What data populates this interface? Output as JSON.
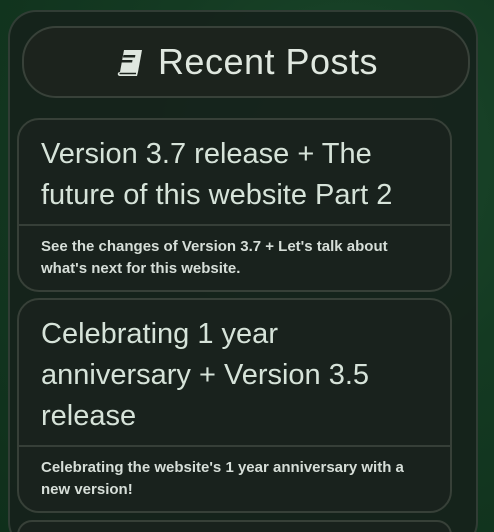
{
  "widget": {
    "title": "Recent Posts",
    "icon": "book-icon",
    "posts": [
      {
        "title": "Version 3.7 release + The future of this website Part 2",
        "description": "See the changes of Version 3.7 + Let's talk about what's next for this website."
      },
      {
        "title": "Celebrating 1 year anniversary + Version 3.5 release",
        "description": "Celebrating the website's 1 year anniversary with a new version!"
      }
    ]
  },
  "colors": {
    "background": "#143a22",
    "panel": "#16221b",
    "text": "#d6e3d9"
  }
}
